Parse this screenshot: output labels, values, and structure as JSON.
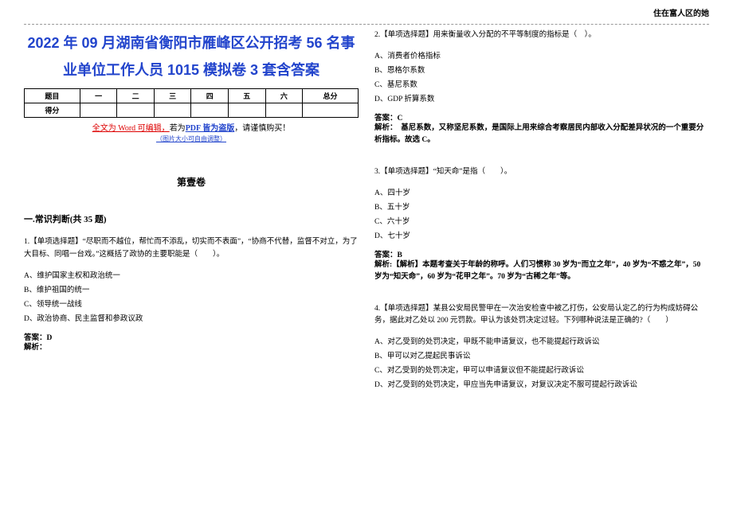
{
  "header": {
    "top_right": "住在富人区的她"
  },
  "title": "2022 年 09 月湖南省衡阳市雁峰区公开招考 56 名事业单位工作人员 1015 模拟卷 3 套含答案",
  "score_table": {
    "row1": [
      "题目",
      "一",
      "二",
      "三",
      "四",
      "五",
      "六",
      "总分"
    ],
    "row2": [
      "得分",
      "",
      "",
      "",
      "",
      "",
      "",
      ""
    ]
  },
  "notice": {
    "prefix": "全文为 Word 可编辑，",
    "mid": "若为",
    "link": "PDF 皆为盗版",
    "suffix": "，请谨慎购买！"
  },
  "small_note": "（图片大小可自由调整）",
  "volume": "第壹卷",
  "section1": "一.常识判断(共 35 题)",
  "q1": {
    "stem": "1.【单项选择题】“尽职而不越位，帮忙而不添乱，切实而不表面”，“协商不代替，监督不对立，为了大目标、同唱一台戏。”这概括了政协的主要职能是（　　）。",
    "opts": [
      "A、维护国家主权和政治统一",
      "B、维护祖国的统一",
      "C、领导统一战线",
      "D、政治协商、民主监督和参政议政"
    ],
    "ans": "答案：D",
    "expl": "解析："
  },
  "q2": {
    "stem": "2.【单项选择题】用来衡量收入分配的不平等制度的指标是（　）。",
    "opts": [
      "A、消费者价格指标",
      "B、恩格尔系数",
      "C、基尼系数",
      "D、GDP 折算系数"
    ],
    "ans": "答案：C",
    "expl": "解析：　基尼系数，又称坚尼系数，是国际上用来综合考察居民内部收入分配差异状况的一个重要分析指标。故选 C。"
  },
  "q3": {
    "stem": "3.【单项选择题】“知天命”是指（　　）。",
    "opts": [
      "A、四十岁",
      "B、五十岁",
      "C、六十岁",
      "D、七十岁"
    ],
    "ans": "答案：B",
    "expl": "解析:【解析】本题考查关于年龄的称呼。人们习惯称 30 岁为“而立之年”，40 岁为“不惑之年”，50 岁为“知天命”，60 岁为“花甲之年”。70 岁为“古稀之年”等。"
  },
  "q4": {
    "stem": "4.【单项选择题】某县公安局民警甲在一次治安检查中被乙打伤，公安局认定乙的行为构成妨碍公务，据此对乙处以 200 元罚款。甲认为该处罚决定过轻。下列哪种说法是正确的?（　　）",
    "opts": [
      "A、对乙受到的处罚决定，甲既不能申请复议，也不能提起行政诉讼",
      "B、甲可以对乙提起民事诉讼",
      "C、对乙受到的处罚决定，甲可以申请复议但不能提起行政诉讼",
      "D、对乙受到的处罚决定，甲应当先申请复议，对复议决定不服可提起行政诉讼"
    ]
  }
}
